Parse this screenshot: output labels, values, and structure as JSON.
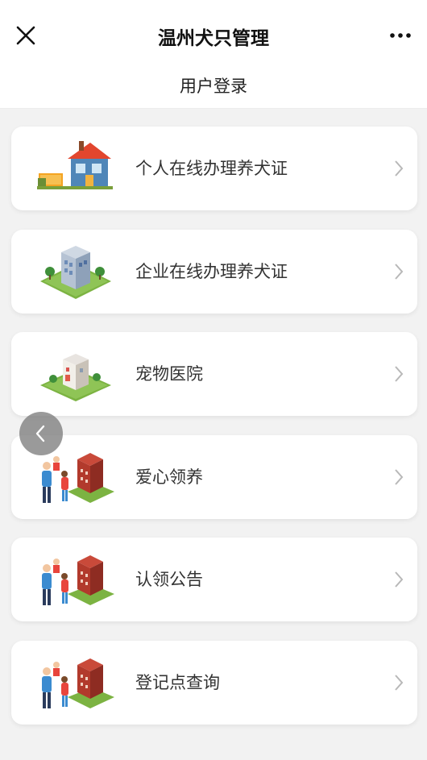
{
  "nav": {
    "title": "温州犬只管理",
    "close_icon": "close-icon",
    "more_icon": "more-icon"
  },
  "header": {
    "title": "用户登录"
  },
  "menu": [
    {
      "label": "个人在线办理养犬证",
      "icon": "house-icon"
    },
    {
      "label": "企业在线办理养犬证",
      "icon": "office-building-icon"
    },
    {
      "label": "宠物医院",
      "icon": "hospital-icon"
    },
    {
      "label": "爱心领养",
      "icon": "family-building-icon"
    },
    {
      "label": "认领公告",
      "icon": "family-building-icon"
    },
    {
      "label": "登记点查询",
      "icon": "family-building-icon"
    }
  ],
  "colors": {
    "background": "#f2f2f2",
    "card": "#ffffff",
    "chevron": "#b8b8b8"
  },
  "floating_button_icon": "back-arrow-icon"
}
